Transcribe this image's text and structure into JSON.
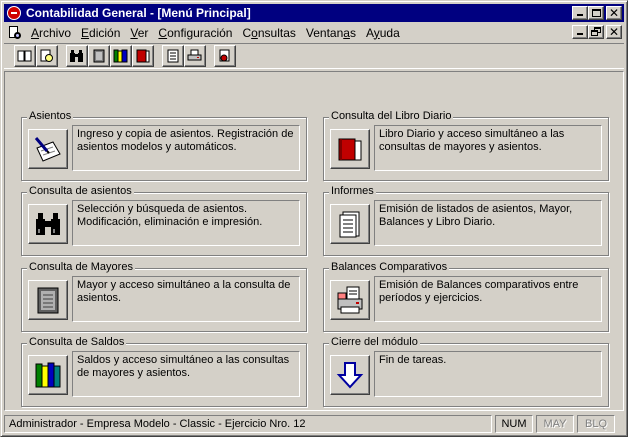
{
  "window": {
    "title": "Contabilidad General - [Menú Principal]"
  },
  "menu": {
    "items": [
      {
        "u": "A",
        "rest": "rchivo"
      },
      {
        "u": "E",
        "rest": "dición"
      },
      {
        "u": "V",
        "rest": "er"
      },
      {
        "u": "C",
        "rest": "onfiguración"
      },
      {
        "pre": "C",
        "u": "o",
        "rest": "nsultas"
      },
      {
        "pre": "Ventan",
        "u": "a",
        "rest": "s"
      },
      {
        "pre": "A",
        "u": "y",
        "rest": "uda"
      }
    ]
  },
  "toolbar": {
    "buttons": [
      "book-icon",
      "eye-icon",
      "binoculars-icon",
      "ledger-icon",
      "books-icon",
      "red-book-icon",
      "list-icon",
      "print-icon",
      "exit-icon"
    ]
  },
  "modules": [
    {
      "label": "Asientos",
      "icon": "pen-notepad-icon",
      "description": "Ingreso y copia de asientos. Registración de asientos modelos y automáticos."
    },
    {
      "label": "Consulta del Libro Diario",
      "icon": "red-book-icon",
      "description": "Libro Diario y acceso simultáneo a las consultas de mayores y asientos."
    },
    {
      "label": "Consulta de asientos",
      "icon": "binoculars-icon",
      "description": "Selección y búsqueda de asientos. Modificación, eliminación e impresión."
    },
    {
      "label": "Informes",
      "icon": "report-icon",
      "description": "Emisión de listados de asientos, Mayor, Balances y Libro Diario."
    },
    {
      "label": "Consulta de Mayores",
      "icon": "ledger-icon",
      "description": "Mayor y acceso simultáneo a la consulta de asientos."
    },
    {
      "label": "Balances Comparativos",
      "icon": "balance-print-icon",
      "description": "Emisión de Balances comparativos entre períodos y ejercicios."
    },
    {
      "label": "Consulta de Saldos",
      "icon": "books-icon",
      "description": "Saldos y acceso simultáneo a las consultas de mayores y asientos."
    },
    {
      "label": "Cierre del módulo",
      "icon": "down-arrow-icon",
      "description": "Fin de tareas."
    }
  ],
  "status": {
    "main": "Administrador - Empresa Modelo - Classic - Ejercicio Nro. 12",
    "num": "NUM",
    "may": "MAY",
    "blq": "BLQ"
  },
  "colors": {
    "title_bar": "#000080",
    "face": "#d4d0c8"
  }
}
